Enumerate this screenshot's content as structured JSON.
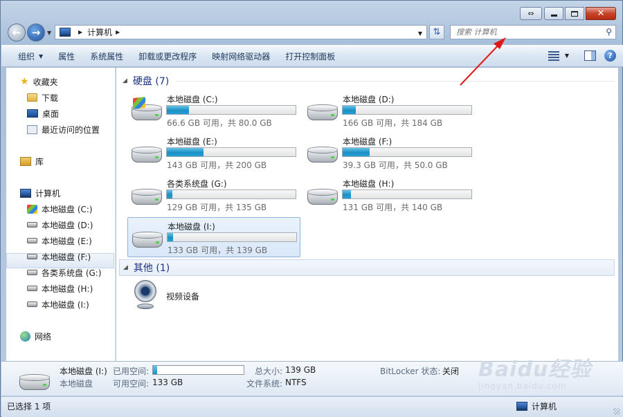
{
  "window": {
    "minimize_icon": "minimize-icon",
    "maximize_icon": "maximize-icon",
    "close_icon": "close-icon",
    "restore_icon": "restore-icon"
  },
  "nav": {
    "back_icon": "back-arrow-icon",
    "forward_icon": "forward-arrow-icon",
    "address_location": "计算机",
    "search_placeholder": "搜索 计算机"
  },
  "toolbar": {
    "items": [
      "组织",
      "属性",
      "系统属性",
      "卸载或更改程序",
      "映射网络驱动器",
      "打开控制面板"
    ],
    "view_icon": "change-view-icon",
    "pane_icon": "preview-pane-icon",
    "help_icon": "help-icon"
  },
  "sidebar": {
    "favorites": "收藏夹",
    "downloads": "下载",
    "desktop": "桌面",
    "recent": "最近访问的位置",
    "libraries": "库",
    "computer": "计算机",
    "drives": [
      "本地磁盘 (C:)",
      "本地磁盘 (D:)",
      "本地磁盘 (E:)",
      "本地磁盘 (F:)",
      "各类系统盘 (G:)",
      "本地磁盘 (H:)",
      "本地磁盘 (I:)"
    ],
    "network": "网络"
  },
  "content": {
    "hdd_group": "硬盘 (7)",
    "other_group": "其他 (1)",
    "drives": [
      {
        "name": "本地磁盘 (C:)",
        "size": "66.6 GB 可用，共 80.0 GB",
        "used_fraction": 0.17
      },
      {
        "name": "本地磁盘 (D:)",
        "size": "166 GB 可用，共 184 GB",
        "used_fraction": 0.1
      },
      {
        "name": "本地磁盘 (E:)",
        "size": "143 GB 可用，共 200 GB",
        "used_fraction": 0.285
      },
      {
        "name": "本地磁盘 (F:)",
        "size": "39.3 GB 可用，共 50.0 GB",
        "used_fraction": 0.21
      },
      {
        "name": "各类系统盘 (G:)",
        "size": "129 GB 可用，共 135 GB",
        "used_fraction": 0.045
      },
      {
        "name": "本地磁盘 (H:)",
        "size": "131 GB 可用，共 140 GB",
        "used_fraction": 0.065
      },
      {
        "name": "本地磁盘 (I:)",
        "size": "133 GB 可用，共 139 GB",
        "used_fraction": 0.043
      }
    ],
    "video_device": "视频设备"
  },
  "details": {
    "name": "本地磁盘 (I:)",
    "type": "本地磁盘",
    "used_label": "已用空间:",
    "free_label": "可用空间:",
    "free_value": "133 GB",
    "total_label": "总大小:",
    "total_value": "139 GB",
    "fs_label": "文件系统:",
    "fs_value": "NTFS",
    "bitlocker_label": "BitLocker 状态:",
    "bitlocker_value": "关闭",
    "used_fraction": 0.043
  },
  "status": {
    "selected": "已选择 1 项",
    "location": "计算机"
  },
  "watermark": {
    "brand": "Baidu经验",
    "url": "jingyan.baidu.com"
  },
  "colors": {
    "accent": "#1b8fc4",
    "annotation_arrow": "#e01818"
  }
}
